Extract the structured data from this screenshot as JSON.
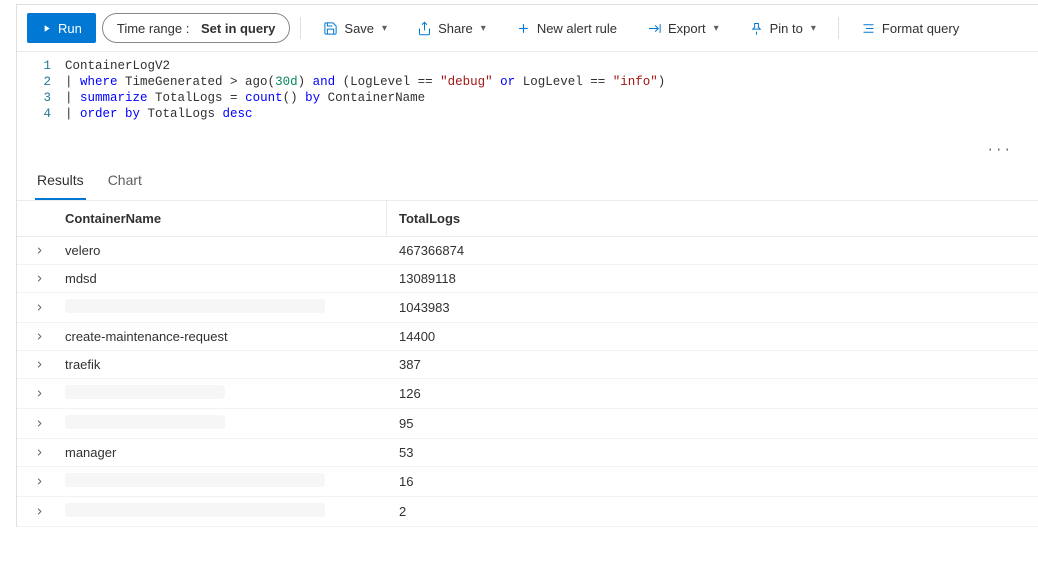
{
  "toolbar": {
    "run_label": "Run",
    "time_range_label": "Time range :",
    "time_range_value": "Set in query",
    "save_label": "Save",
    "share_label": "Share",
    "new_alert_label": "New alert rule",
    "export_label": "Export",
    "pin_label": "Pin to",
    "format_label": "Format query"
  },
  "editor": {
    "lines": [
      {
        "n": "1",
        "tokens": [
          {
            "t": "ContainerLogV2",
            "c": ""
          }
        ]
      },
      {
        "n": "2",
        "tokens": [
          {
            "t": "| ",
            "c": ""
          },
          {
            "t": "where",
            "c": "kw"
          },
          {
            "t": " TimeGenerated > ago(",
            "c": ""
          },
          {
            "t": "30d",
            "c": "num"
          },
          {
            "t": ") ",
            "c": ""
          },
          {
            "t": "and",
            "c": "kw"
          },
          {
            "t": " (LogLevel == ",
            "c": ""
          },
          {
            "t": "\"debug\"",
            "c": "str"
          },
          {
            "t": " ",
            "c": ""
          },
          {
            "t": "or",
            "c": "kw"
          },
          {
            "t": " LogLevel == ",
            "c": ""
          },
          {
            "t": "\"info\"",
            "c": "str"
          },
          {
            "t": ")",
            "c": ""
          }
        ]
      },
      {
        "n": "3",
        "tokens": [
          {
            "t": "| ",
            "c": ""
          },
          {
            "t": "summarize",
            "c": "kw"
          },
          {
            "t": " TotalLogs = ",
            "c": ""
          },
          {
            "t": "count",
            "c": "fn"
          },
          {
            "t": "() ",
            "c": ""
          },
          {
            "t": "by",
            "c": "kw"
          },
          {
            "t": " ContainerName",
            "c": ""
          }
        ]
      },
      {
        "n": "4",
        "tokens": [
          {
            "t": "| ",
            "c": ""
          },
          {
            "t": "order by",
            "c": "kw"
          },
          {
            "t": " TotalLogs ",
            "c": ""
          },
          {
            "t": "desc",
            "c": "kw"
          }
        ]
      }
    ]
  },
  "tabs": {
    "results": "Results",
    "chart": "Chart"
  },
  "columns": {
    "container_name": "ContainerName",
    "total_logs": "TotalLogs"
  },
  "rows": [
    {
      "name": "velero",
      "total": "467366874",
      "redacted": false
    },
    {
      "name": "mdsd",
      "total": "13089118",
      "redacted": false
    },
    {
      "name": "",
      "total": "1043983",
      "redacted": true,
      "wide": true
    },
    {
      "name": "create-maintenance-request",
      "total": "14400",
      "redacted": false
    },
    {
      "name": "traefik",
      "total": "387",
      "redacted": false
    },
    {
      "name": "",
      "total": "126",
      "redacted": true,
      "wide": false
    },
    {
      "name": "",
      "total": "95",
      "redacted": true,
      "wide": false
    },
    {
      "name": "manager",
      "total": "53",
      "redacted": false
    },
    {
      "name": "",
      "total": "16",
      "redacted": true,
      "wide": true
    },
    {
      "name": "",
      "total": "2",
      "redacted": true,
      "wide": true
    }
  ]
}
